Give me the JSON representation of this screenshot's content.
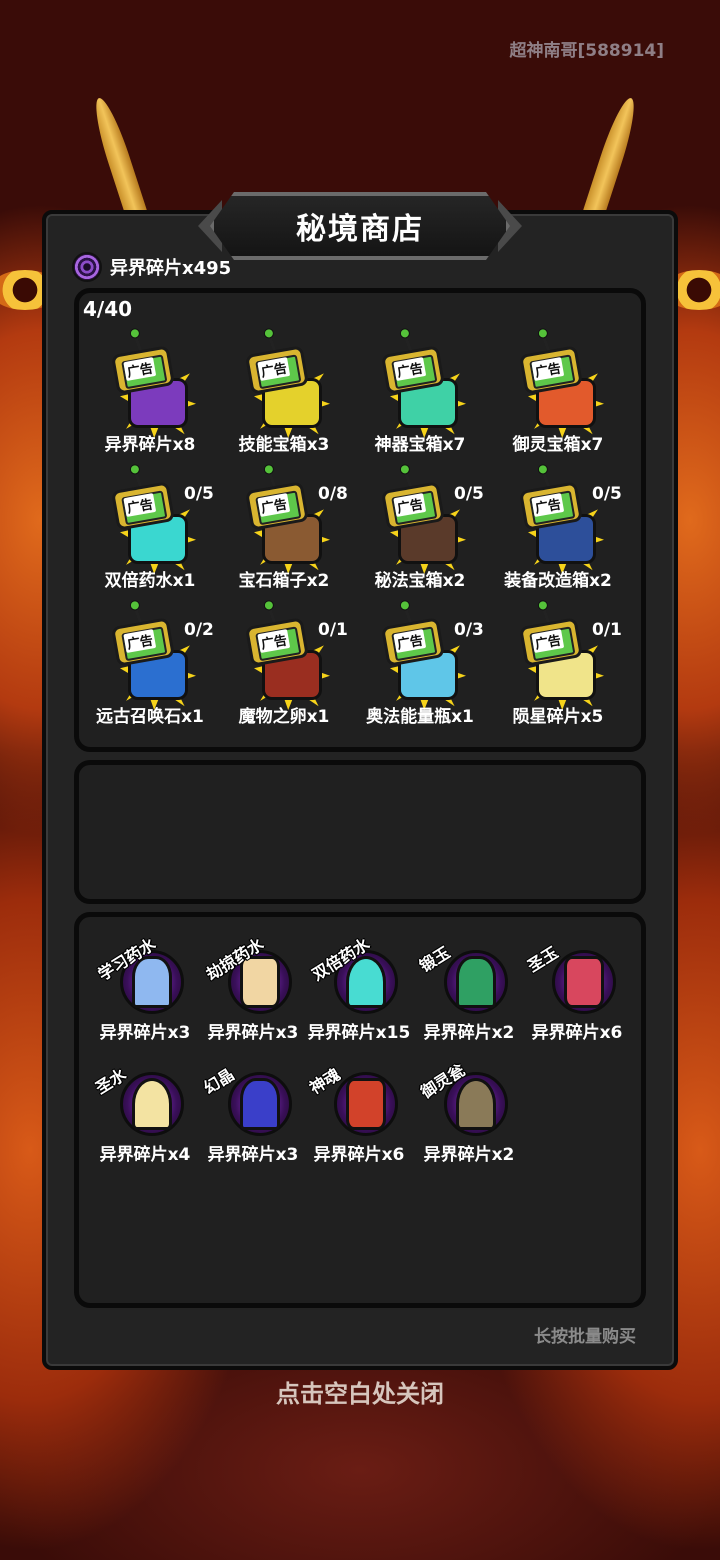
{
  "user": {
    "name": "超神南哥[588914]"
  },
  "shop": {
    "title": "秘境商店",
    "currency": "异界碎片x495",
    "ad_count": "4/40",
    "ad_badge": "广告",
    "ad_items": [
      {
        "name": "异界碎片x8",
        "limit": "",
        "color": "#7c3bbd"
      },
      {
        "name": "技能宝箱x3",
        "limit": "",
        "color": "#e4d12c"
      },
      {
        "name": "神器宝箱x7",
        "limit": "",
        "color": "#3fd1a6"
      },
      {
        "name": "御灵宝箱x7",
        "limit": "",
        "color": "#e25a2c"
      },
      {
        "name": "双倍药水x1",
        "limit": "0/5",
        "color": "#3ad7d0"
      },
      {
        "name": "宝石箱子x2",
        "limit": "0/8",
        "color": "#8a5a32"
      },
      {
        "name": "秘法宝箱x2",
        "limit": "0/5",
        "color": "#5a3a2a"
      },
      {
        "name": "装备改造箱x2",
        "limit": "0/5",
        "color": "#2d4f9a"
      },
      {
        "name": "远古召唤石x1",
        "limit": "0/2",
        "color": "#2b6fd0"
      },
      {
        "name": "魔物之卵x1",
        "limit": "0/1",
        "color": "#9a2e20"
      },
      {
        "name": "奥法能量瓶x1",
        "limit": "0/3",
        "color": "#5fc6e8"
      },
      {
        "name": "陨星碎片x5",
        "limit": "0/1",
        "color": "#f0e48a"
      }
    ],
    "shop_items": [
      {
        "label": "学习药水",
        "price": "异界碎片x3",
        "color": "#8fb8f0"
      },
      {
        "label": "劫掠药水",
        "price": "异界碎片x3",
        "color": "#f1d6a3"
      },
      {
        "label": "双倍药水",
        "price": "异界碎片x15",
        "color": "#48dcd2"
      },
      {
        "label": "锻玉",
        "price": "异界碎片x2",
        "color": "#2fa063"
      },
      {
        "label": "圣玉",
        "price": "异界碎片x6",
        "color": "#d8475e"
      },
      {
        "label": "圣水",
        "price": "异界碎片x4",
        "color": "#f3e3a2"
      },
      {
        "label": "幻晶",
        "price": "异界碎片x3",
        "color": "#3a3fc9"
      },
      {
        "label": "神魂",
        "price": "异界碎片x6",
        "color": "#d2422a"
      },
      {
        "label": "御灵瓮",
        "price": "异界碎片x2",
        "color": "#8a7a58"
      }
    ],
    "hint": "长按批量购买",
    "close_hint": "点击空白处关闭"
  }
}
